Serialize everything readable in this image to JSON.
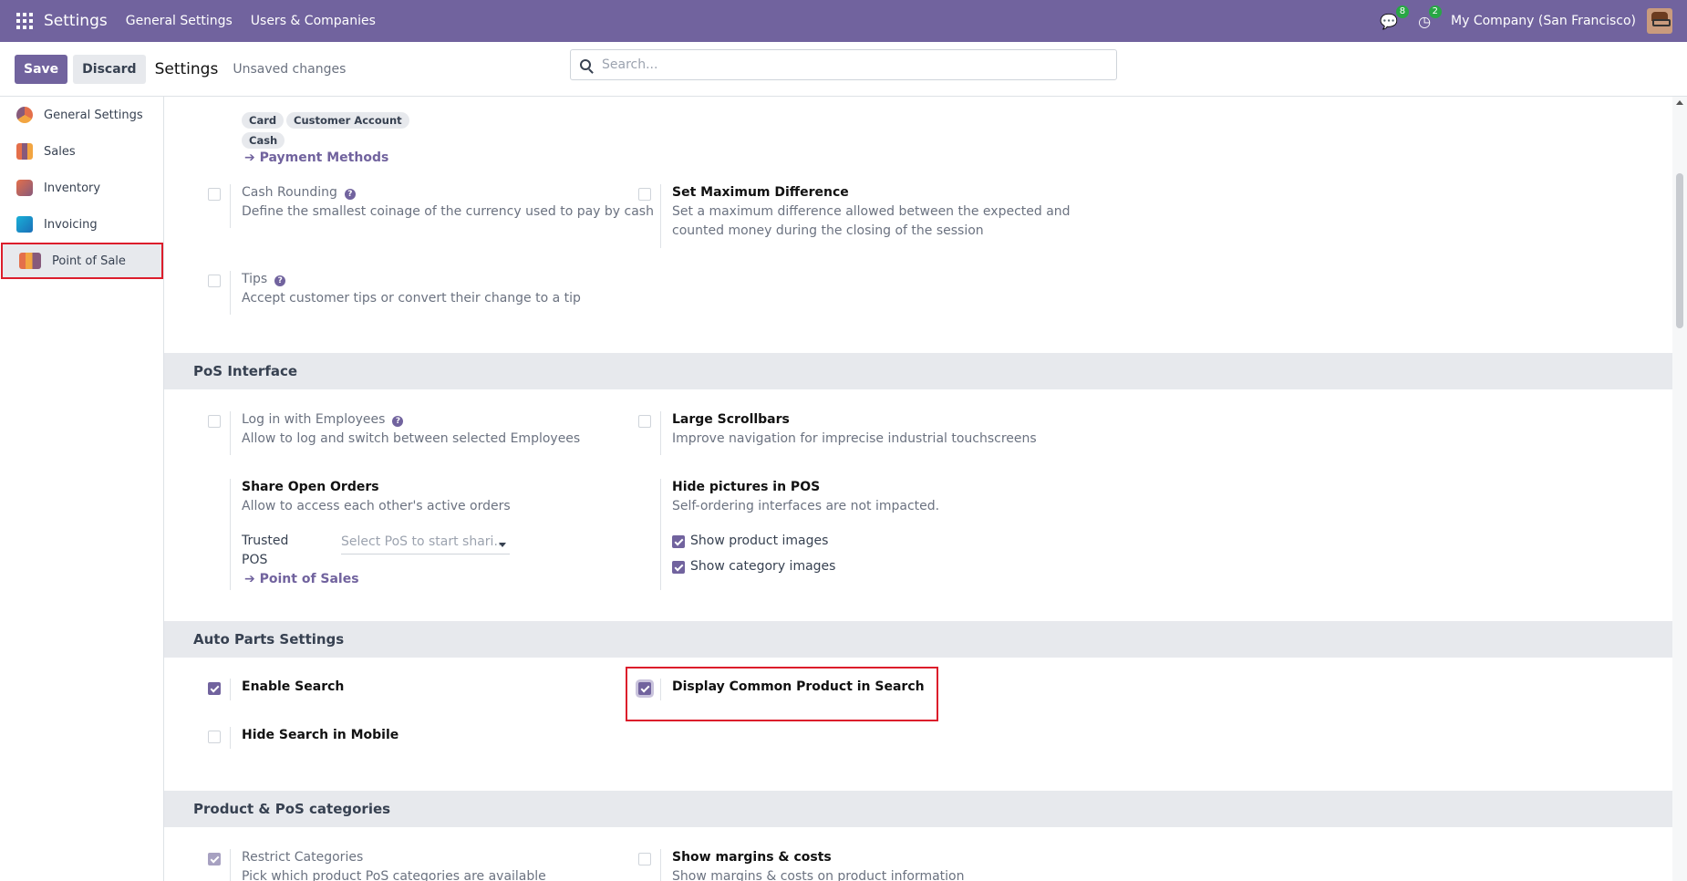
{
  "topnav": {
    "app_title": "Settings",
    "links": [
      "General Settings",
      "Users & Companies"
    ],
    "messages_count": "8",
    "activities_count": "2",
    "company": "My Company (San Francisco)"
  },
  "controlbar": {
    "save_label": "Save",
    "discard_label": "Discard",
    "title": "Settings",
    "status": "Unsaved changes",
    "search_placeholder": "Search..."
  },
  "sidebar": {
    "items": [
      {
        "label": "General Settings",
        "icon": "general-settings-icon"
      },
      {
        "label": "Sales",
        "icon": "sales-icon"
      },
      {
        "label": "Inventory",
        "icon": "inventory-icon"
      },
      {
        "label": "Invoicing",
        "icon": "invoicing-icon"
      },
      {
        "label": "Point of Sale",
        "icon": "point-of-sale-icon",
        "active": true
      }
    ]
  },
  "payment": {
    "tags": [
      "Card",
      "Customer Account",
      "Cash"
    ],
    "link": "Payment Methods"
  },
  "payment_settings": {
    "cash_rounding": {
      "title": "Cash Rounding",
      "desc": "Define the smallest coinage of the currency used to pay by cash",
      "checked": false
    },
    "max_difference": {
      "title": "Set Maximum Difference",
      "desc_1": "Set a maximum difference allowed between the expected and",
      "desc_2": "counted money during the closing of the session",
      "checked": false
    },
    "tips": {
      "title": "Tips",
      "desc": "Accept customer tips or convert their change to a tip",
      "checked": false
    }
  },
  "pos_interface": {
    "header": "PoS Interface",
    "login_employees": {
      "title": "Log in with Employees",
      "desc": "Allow to log and switch between selected Employees",
      "checked": false
    },
    "large_scrollbars": {
      "title": "Large Scrollbars",
      "desc": "Improve navigation for imprecise industrial touchscreens",
      "checked": false
    },
    "share_orders": {
      "title": "Share Open Orders",
      "desc": "Allow to access each other's active orders",
      "trusted_label_1": "Trusted",
      "trusted_label_2": "POS",
      "select_placeholder": "Select PoS to start shari...",
      "link": "Point of Sales"
    },
    "hide_pictures": {
      "title": "Hide pictures in POS",
      "desc": "Self-ordering interfaces are not impacted.",
      "opt1": "Show product images",
      "opt2": "Show category images",
      "opt1_checked": true,
      "opt2_checked": true
    }
  },
  "auto_parts": {
    "header": "Auto Parts Settings",
    "enable_search": {
      "title": "Enable Search",
      "checked": true
    },
    "display_common": {
      "title": "Display Common Product in Search",
      "checked": true
    },
    "hide_mobile": {
      "title": "Hide Search in Mobile",
      "checked": false
    }
  },
  "categories": {
    "header": "Product & PoS categories",
    "restrict": {
      "title": "Restrict Categories",
      "desc": "Pick which product PoS categories are available",
      "checked": true
    },
    "margins": {
      "title": "Show margins & costs",
      "desc": "Show margins & costs on product information",
      "checked": false
    }
  }
}
